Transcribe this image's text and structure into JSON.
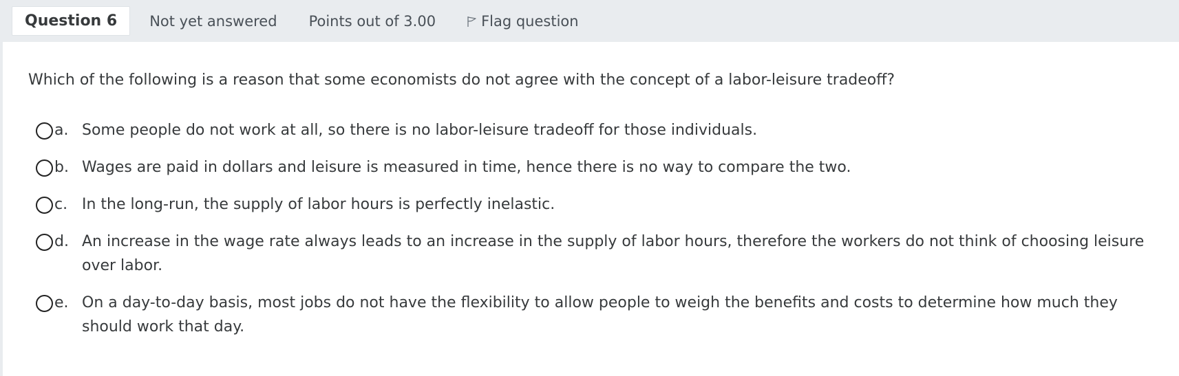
{
  "header": {
    "question_label": "Question 6",
    "status": "Not yet answered",
    "points": "Points out of 3.00",
    "flag_label": "Flag question"
  },
  "question": {
    "text": "Which of the following is a reason that some economists do not agree with the concept of a labor-leisure tradeoff?"
  },
  "options": [
    {
      "letter": "a.",
      "text": "Some people do not work at all, so there is no labor-leisure tradeoff for those individuals."
    },
    {
      "letter": "b.",
      "text": "Wages are paid in dollars and leisure is measured in time, hence there is no way to compare the two."
    },
    {
      "letter": "c.",
      "text": "In the long-run, the supply of labor hours is perfectly inelastic."
    },
    {
      "letter": "d.",
      "text": "An increase in the wage rate always leads to an increase in the supply of labor hours, therefore the workers do not think of choosing leisure over labor."
    },
    {
      "letter": "e.",
      "text": "On a day-to-day basis, most jobs do not have the flexibility to allow people to weigh the benefits and costs to determine how much they should work that day."
    }
  ],
  "icons": {
    "flag": "flag-icon",
    "radio": "radio-unchecked-icon"
  },
  "colors": {
    "header_bg": "#e9ecef",
    "text": "#373a3c"
  }
}
